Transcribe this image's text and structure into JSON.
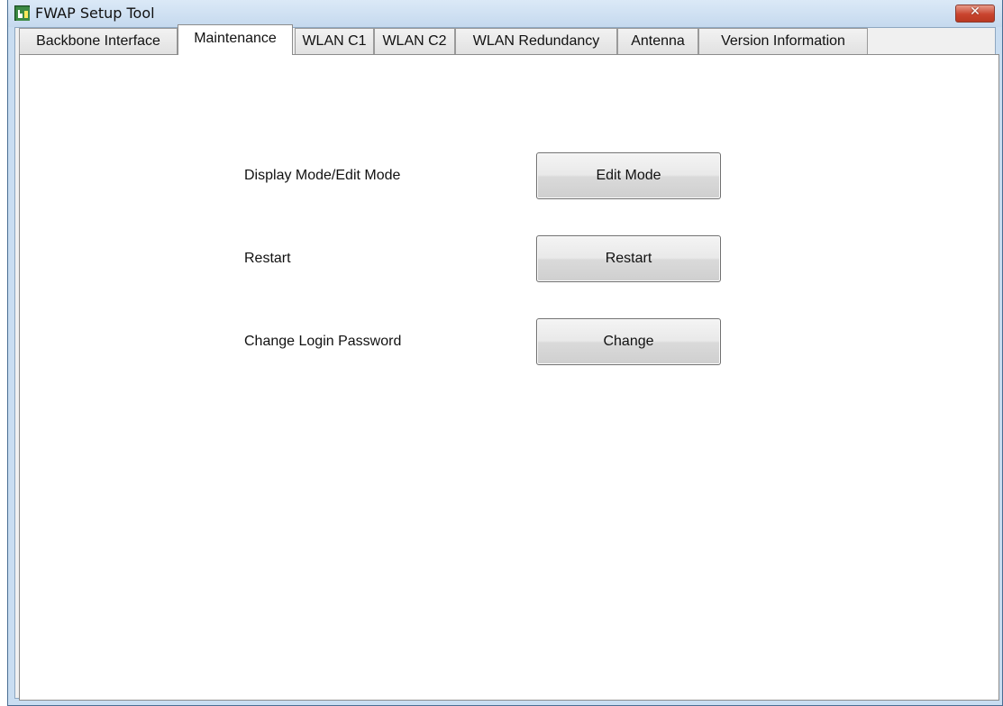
{
  "window": {
    "title": "FWAP Setup Tool",
    "close_symbol": "✕",
    "app_icon": "fwap-app-icon"
  },
  "tabs": [
    {
      "label": "Backbone Interface",
      "active": false
    },
    {
      "label": "Maintenance",
      "active": true
    },
    {
      "label": "WLAN C1",
      "active": false
    },
    {
      "label": "WLAN C2",
      "active": false
    },
    {
      "label": "WLAN Redundancy",
      "active": false
    },
    {
      "label": "Antenna",
      "active": false
    },
    {
      "label": "Version Information",
      "active": false
    }
  ],
  "maintenance": {
    "rows": [
      {
        "label": "Display Mode/Edit Mode",
        "button": "Edit Mode"
      },
      {
        "label": "Restart",
        "button": "Restart"
      },
      {
        "label": "Change Login Password",
        "button": "Change"
      }
    ]
  },
  "colors": {
    "title_bar": "#c5d9ee",
    "close_button": "#c9442e",
    "panel_background": "#ffffff"
  }
}
